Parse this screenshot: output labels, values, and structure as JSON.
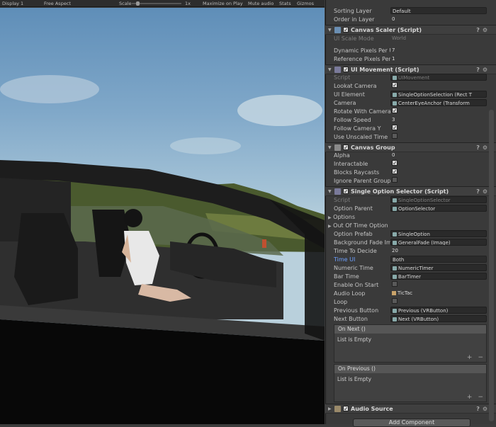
{
  "game_toolbar": {
    "display": "Display 1",
    "aspect": "Free Aspect",
    "scale_label": "Scale",
    "scale_value": "1x",
    "maximize": "Maximize on Play",
    "mute": "Mute audio",
    "stats": "Stats",
    "gizmos": "Gizmos"
  },
  "top_props": [
    {
      "label": "Sorting Layer",
      "value": "Default"
    },
    {
      "label": "Order in Layer",
      "value": "0"
    }
  ],
  "canvas_scaler": {
    "title": "Canvas Scaler (Script)",
    "ui_scale_mode_label": "UI Scale Mode",
    "ui_scale_mode_value": "World",
    "dynamic_label": "Dynamic Pixels Per U",
    "dynamic_value": "7",
    "reference_label": "Reference Pixels Per",
    "reference_value": "1"
  },
  "ui_movement": {
    "title": "UI Movement (Script)",
    "script_label": "Script",
    "script_value": "UIMovement",
    "lookat_label": "Lookat Camera",
    "ui_element_label": "UI Element",
    "ui_element_value": "SingleOptionSelection (Rect T",
    "camera_label": "Camera",
    "camera_value": "CenterEyeAnchor (Transform",
    "rotate_label": "Rotate With Camera",
    "follow_speed_label": "Follow Speed",
    "follow_speed_value": "3",
    "follow_y_label": "Follow Camera Y",
    "unscaled_label": "Use Unscaled Time"
  },
  "canvas_group": {
    "title": "Canvas Group",
    "alpha_label": "Alpha",
    "alpha_value": "0",
    "interactable_label": "Interactable",
    "blocks_label": "Blocks Raycasts",
    "ignore_label": "Ignore Parent Group"
  },
  "single_option": {
    "title": "Single Option Selector (Script)",
    "script_label": "Script",
    "script_value": "SingleOptionSelector",
    "option_parent_label": "Option Parent",
    "option_parent_value": "OptionSelector",
    "options_label": "Options",
    "out_of_time_label": "Out Of Time Option",
    "option_prefab_label": "Option Prefab",
    "option_prefab_value": "SingleOption",
    "bg_fade_label": "Background Fade Im",
    "bg_fade_value": "GeneralFade (Image)",
    "time_to_decide_label": "Time To Decide",
    "time_to_decide_value": "20",
    "time_ui_label": "Time UI",
    "time_ui_value": "Both",
    "numeric_time_label": "Numeric Time",
    "numeric_time_value": "NumericTimer",
    "bar_time_label": "Bar Time",
    "bar_time_value": "BarTimer",
    "enable_on_start_label": "Enable On Start",
    "audio_loop_label": "Audio Loop",
    "audio_loop_value": "TicTac",
    "loop_label": "Loop",
    "previous_button_label": "Previous Button",
    "previous_button_value": "Previous (VRButton)",
    "next_button_label": "Next Button",
    "next_button_value": "Next (VRButton)",
    "on_next_title": "On Next ()",
    "on_next_body": "List is Empty",
    "on_previous_title": "On Previous ()",
    "on_previous_body": "List is Empty"
  },
  "audio_source": {
    "title": "Audio Source"
  },
  "add_component": "Add Component",
  "colors": {
    "sky": "#8fb3cf",
    "inspector_bg": "#3a3a3a",
    "header_bg": "#3f3f3f"
  },
  "icons": [
    "foldout-arrow-icon",
    "checkbox-icon",
    "help-icon",
    "settings-gear-icon",
    "object-picker-icon"
  ]
}
